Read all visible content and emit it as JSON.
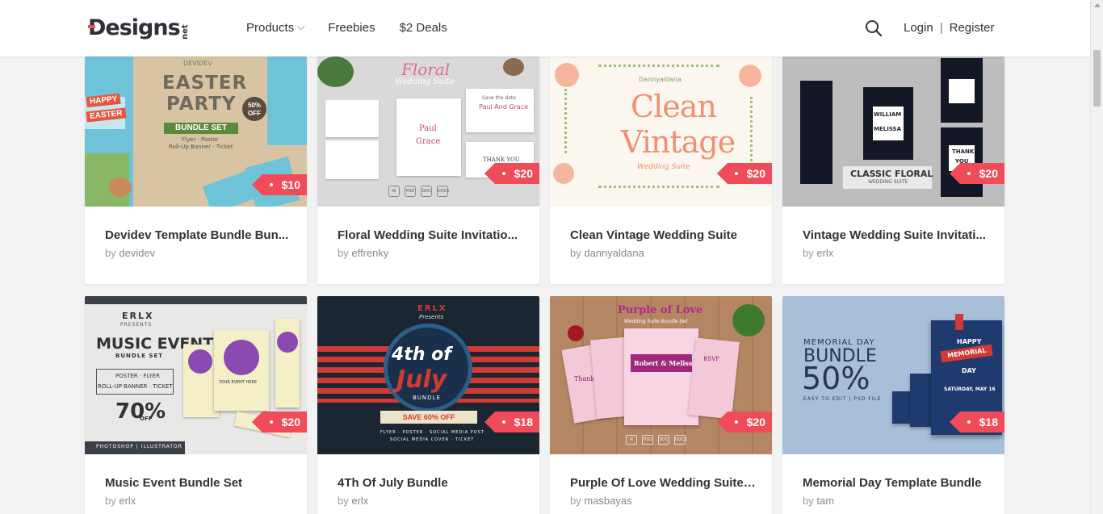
{
  "header": {
    "logo": "Designs",
    "logo_suffix": "net",
    "nav": [
      {
        "label": "Products",
        "has_dropdown": true
      },
      {
        "label": "Freebies",
        "has_dropdown": false
      },
      {
        "label": "$2 Deals",
        "has_dropdown": false
      }
    ],
    "search_icon": "search-icon",
    "login": "Login",
    "separator": "|",
    "register": "Register"
  },
  "colors": {
    "accent": "#f04b59",
    "text": "#333333",
    "muted": "#999999"
  },
  "cards": [
    {
      "title": "Devidev Template Bundle Bun...",
      "by": "by",
      "author": "devidev",
      "price": "$10",
      "art": {
        "brand": "DEVIDEV",
        "line1": "EASTER",
        "line2": "PARTY",
        "band": "BUNDLE SET",
        "sub": "Flyer · Poster",
        "sub2": "Roll-Up Banner · Ticket",
        "badge": "50%",
        "badge2": "OFF",
        "tag1": "HAPPY",
        "tag2": "EASTER"
      }
    },
    {
      "title": "Floral Wedding Suite Invitatio...",
      "by": "by",
      "author": "effrenky",
      "price": "$20",
      "art": {
        "line1": "Floral",
        "line2": "Wedding Suite",
        "card1": "Save the date",
        "card2": "Paul And Grace",
        "card3": "Paul",
        "card4": "Grace",
        "card5": "THANK YOU",
        "f1": "AI",
        "f2": "PSD",
        "f3": "DOC",
        "f4": "DOCX"
      }
    },
    {
      "title": "Clean Vintage Wedding Suite",
      "by": "by",
      "author": "dannyaldana",
      "price": "$20",
      "art": {
        "brand": "Dannyaldana",
        "line1": "Clean",
        "line2": "Vintage",
        "line3": "Wedding Suite"
      }
    },
    {
      "title": "Vintage Wedding Suite Invitati...",
      "by": "by",
      "author": "erlx",
      "price": "$20",
      "art": {
        "line1": "CLASSIC FLORAL",
        "line2": "WEDDING SUITE",
        "n1": "WILLIAM",
        "n2": "MELISSA",
        "t1": "THANK",
        "t2": "YOU"
      }
    },
    {
      "title": "Music Event Bundle Set",
      "by": "by",
      "author": "erlx",
      "price": "$20",
      "art": {
        "brand": "ERLX",
        "presents": "PRESENTS",
        "line1": "MUSIC EVENT",
        "line2": "BUNDLE SET",
        "box1": "POSTER · FLYER",
        "box2": "ROLL-UP BANNER · TICKET",
        "pct": "70%",
        "off": "OFF",
        "footer": "PHOTOSHOP | ILLUSTRATOR",
        "ev": "YOUR EVENT HERE"
      }
    },
    {
      "title": "4Th Of July Bundle",
      "by": "by",
      "author": "erlx",
      "price": "$18",
      "art": {
        "brand": "ERLX",
        "presents": "Presents",
        "line1": "4th of",
        "line2": "July",
        "line3": "BUNDLE",
        "ribbon": "SAVE 60% OFF",
        "foot1": "FLYER · POSTER · SOCIAL MEDIA POST",
        "foot2": "SOCIAL MEDIA COVER · TICKET"
      }
    },
    {
      "title": "Purple Of Love Wedding Suite ...",
      "by": "by",
      "author": "masbayas",
      "price": "$20",
      "art": {
        "line1": "Purple of Love",
        "line2": "Wedding Suite Bundle Set",
        "names": "Robert & Melissa",
        "t1": "Thank",
        "t2": "RSVP",
        "f1": "AI",
        "f2": "PSD",
        "f3": "DOC",
        "f4": "DOCX"
      }
    },
    {
      "title": "Memorial Day Template Bundle",
      "by": "by",
      "author": "tam",
      "price": "$18",
      "art": {
        "line1": "MEMORIAL DAY",
        "line2": "BUNDLE",
        "line3": "50%",
        "line4": "EASY TO EDIT | PSD FILE",
        "b1": "HAPPY",
        "b2": "MEMORIAL",
        "b3": "DAY",
        "date": "SATURDAY, MAY 16"
      }
    }
  ]
}
